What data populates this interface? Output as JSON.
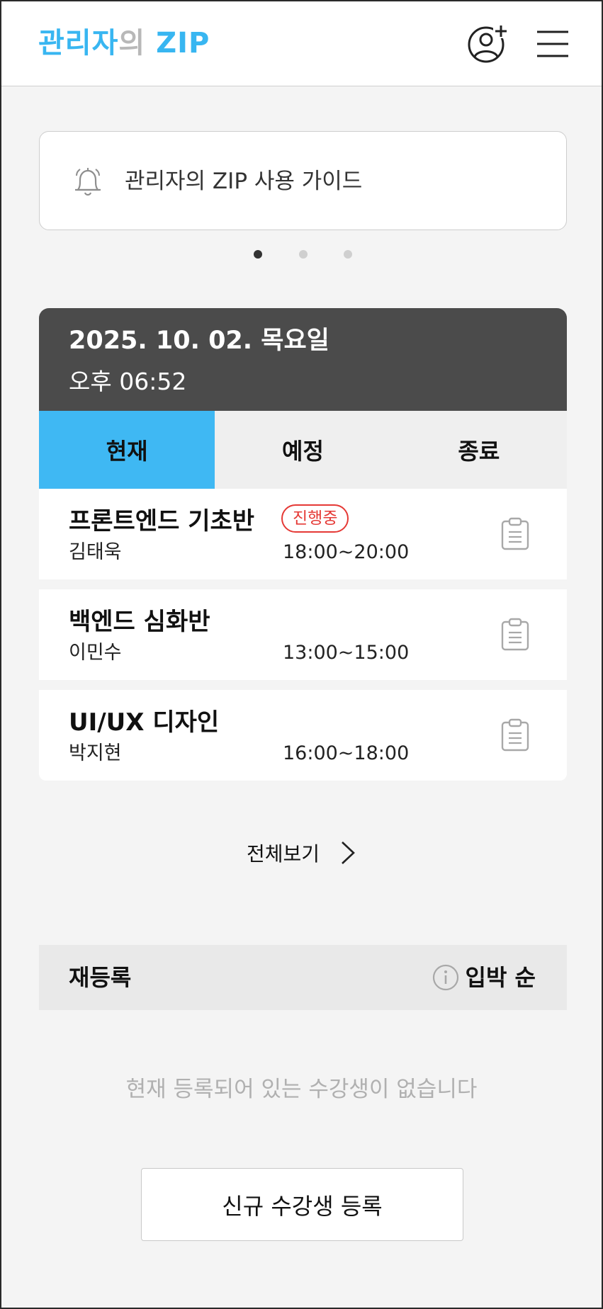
{
  "header": {
    "logo_part1": "관리자",
    "logo_part2": "의",
    "logo_part3": " ZIP"
  },
  "notice": {
    "text": "관리자의 ZIP 사용 가이드",
    "slide_count": 3,
    "active_slide": 1
  },
  "schedule": {
    "date": "2025. 10. 02. 목요일",
    "time": "오후 06:52",
    "tabs": [
      {
        "label": "현재",
        "active": true
      },
      {
        "label": "예정",
        "active": false
      },
      {
        "label": "종료",
        "active": false
      }
    ],
    "classes": [
      {
        "title": "프론트엔드 기초반",
        "teacher": "김태욱",
        "time": "18:00~20:00",
        "badge": "진행중"
      },
      {
        "title": "백엔드 심화반",
        "teacher": "이민수",
        "time": "13:00~15:00"
      },
      {
        "title": "UI/UX 디자인",
        "teacher": "박지현",
        "time": "16:00~18:00"
      }
    ],
    "view_all": "전체보기"
  },
  "reregister": {
    "title": "재등록",
    "sort_label": "입박 순",
    "empty_message": "현재 등록되어 있는 수강생이 없습니다",
    "new_button": "신규 수강생 등록"
  },
  "colors": {
    "accent": "#3fb8f3",
    "header_dark": "#4b4b4b",
    "badge_red": "#e53935"
  },
  "icons": {
    "user_add": "user-add-icon",
    "menu": "hamburger-menu-icon",
    "bell": "bell-icon",
    "clipboard": "clipboard-icon",
    "chevron": "chevron-right-icon",
    "info": "info-icon"
  }
}
